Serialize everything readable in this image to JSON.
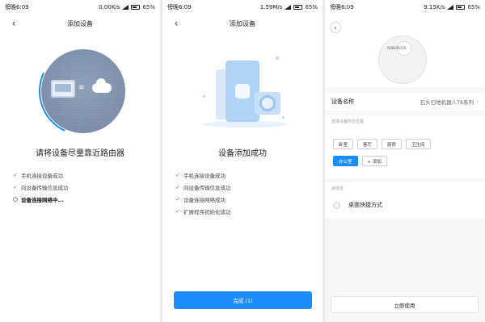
{
  "status": {
    "carrier_time": "傍晚6:09",
    "p1_speed": "0.00K/s",
    "p2_speed": "1.59M/s",
    "p3_speed": "9.15K/s",
    "battery": "65%"
  },
  "p1": {
    "title": "添加设备",
    "headline": "请将设备尽量靠近路由器",
    "steps": [
      "手机连接设备成功",
      "向设备传输信息成功",
      "设备连接网络中..."
    ]
  },
  "p2": {
    "title": "添加设备",
    "headline": "设备添加成功",
    "steps": [
      "手机连接设备成功",
      "向设备传输信息成功",
      "设备连接网络成功",
      "扩展程序初始化成功"
    ],
    "done_button": "完成 (1)"
  },
  "p3": {
    "robot_brand": "ROBOROCK",
    "device_name_label": "设备名称",
    "device_name_value": "石头扫地机器人T6系列",
    "location_label": "选择设备所在位置",
    "rooms": [
      "卧室",
      "客厅",
      "厨房",
      "卫生间"
    ],
    "selected_room": "办公室",
    "add_label": "+ 添加",
    "add_to_label": "添加至",
    "shortcut_label": "桌面快捷方式",
    "start_button": "立即使用"
  },
  "colors": {
    "accent": "#1a8cff",
    "globe": "#7b8da8"
  }
}
